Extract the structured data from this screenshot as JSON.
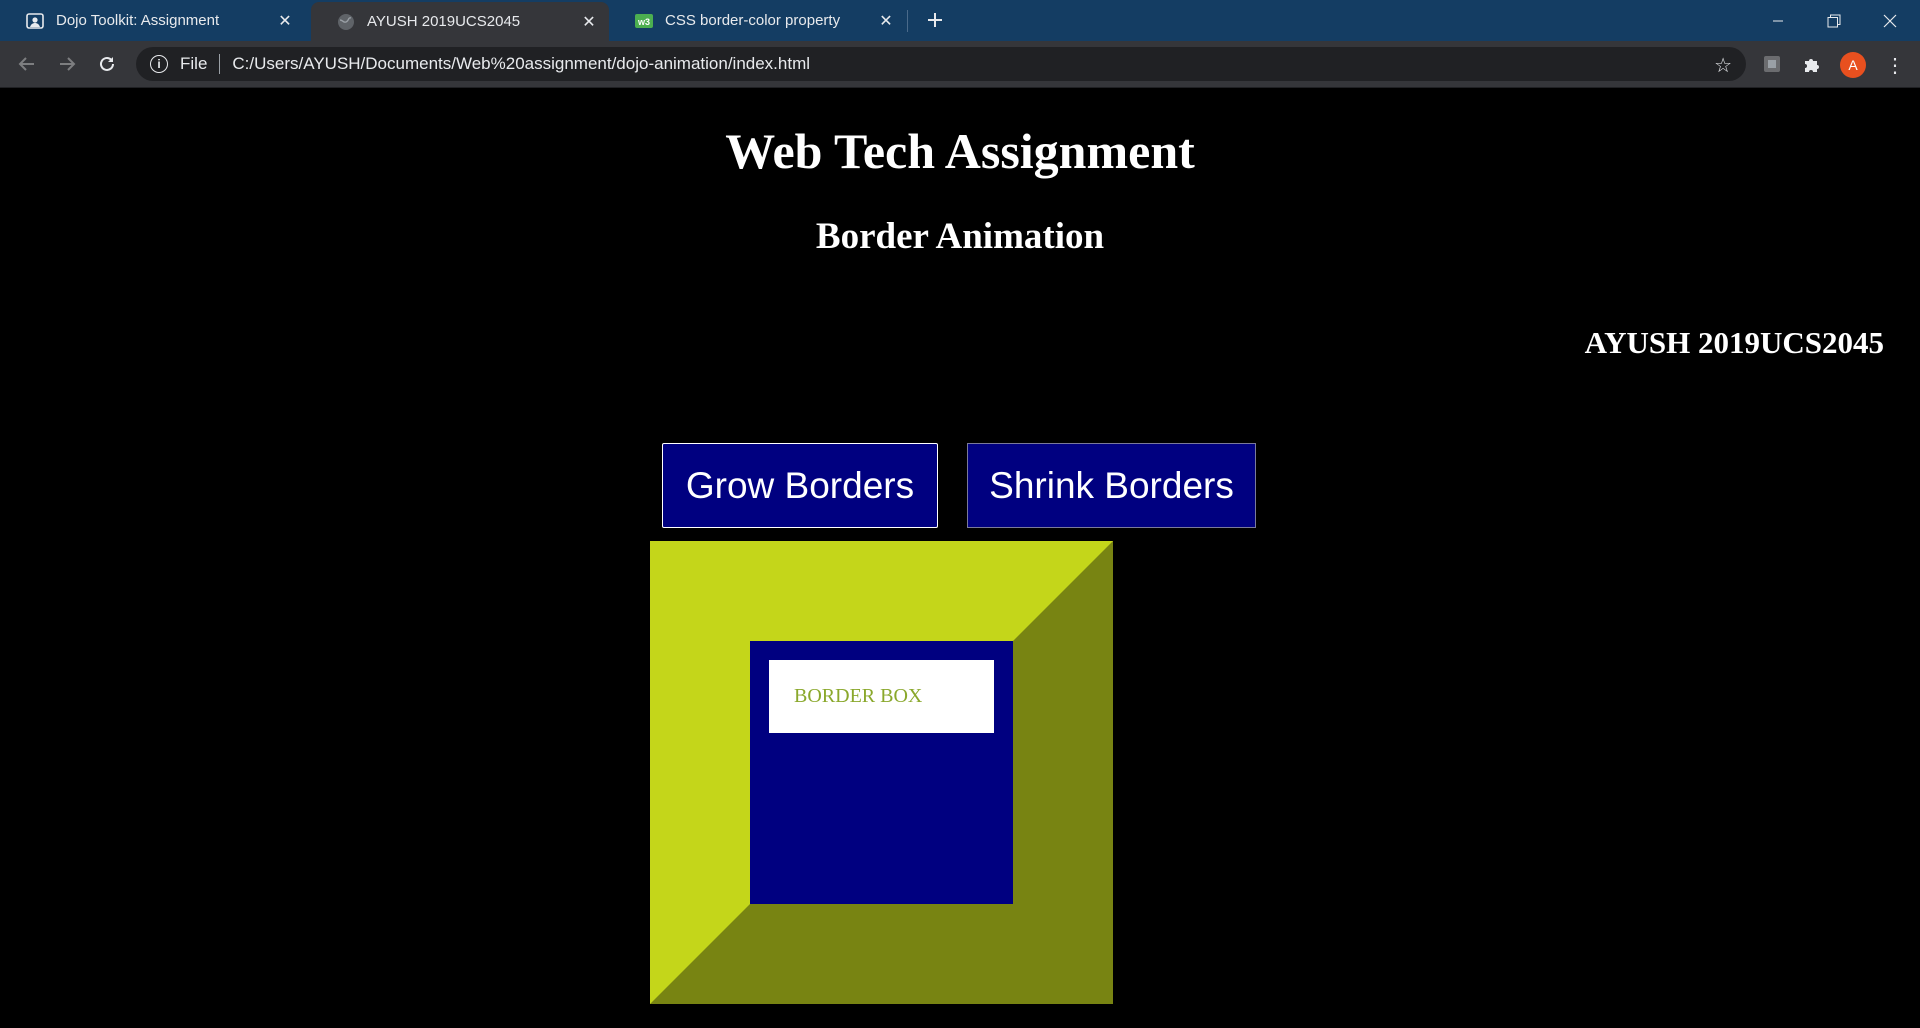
{
  "browser": {
    "tabs": [
      {
        "title": "Dojo Toolkit: Assignment",
        "icon": "person-card-icon",
        "active": false
      },
      {
        "title": "AYUSH 2019UCS2045",
        "icon": "globe-icon",
        "active": true
      },
      {
        "title": "CSS border-color property",
        "icon": "w3schools-icon",
        "active": false
      }
    ],
    "address": {
      "scheme_label": "File",
      "url": "C:/Users/AYUSH/Documents/Web%20assignment/dojo-animation/index.html"
    },
    "profile_initial": "A",
    "colors": {
      "tabstrip": "#143d63",
      "toolbar": "#35363a",
      "avatar": "#e8501f"
    }
  },
  "page": {
    "title": "Web Tech Assignment",
    "subtitle": "Border Animation",
    "author": "AYUSH 2019UCS2045",
    "buttons": {
      "grow": "Grow Borders",
      "shrink": "Shrink Borders"
    },
    "box": {
      "label": "BORDER BOX",
      "colors": {
        "border_light": "#c4d61a",
        "border_dark": "#788412",
        "fill": "#000080",
        "label_text": "#8aa82c"
      }
    }
  }
}
